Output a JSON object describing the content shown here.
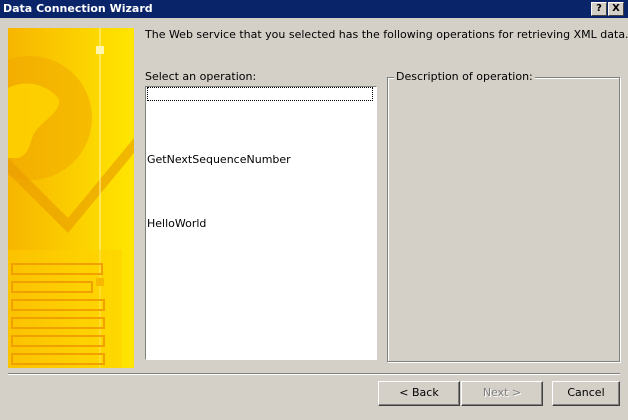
{
  "window": {
    "title": "Data Connection Wizard",
    "help_glyph": "?",
    "close_glyph": "X"
  },
  "wizard": {
    "description": "The Web service that you selected has the following operations for retrieving XML data.",
    "operation_label": "Select an operation:",
    "operations": [
      {
        "name": "",
        "focused": true
      },
      {
        "name": "GetNextSequenceNumber"
      },
      {
        "name": "HelloWorld"
      }
    ],
    "description_group_label": "Description of operation:"
  },
  "buttons": {
    "back": "< Back",
    "next": "Next >",
    "cancel": "Cancel"
  },
  "colors": {
    "titlebar": "#0a246a",
    "banner_light": "#ffe600",
    "banner_dark": "#f5b800",
    "face": "#d4d0c8"
  }
}
